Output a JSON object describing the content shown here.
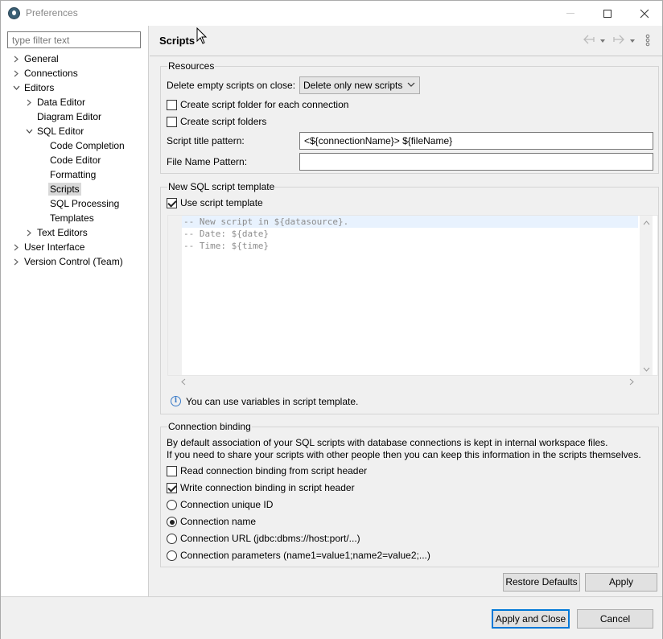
{
  "window": {
    "title": "Preferences",
    "controls": {
      "minimize": "minimize",
      "maximize": "maximize",
      "close": "close"
    }
  },
  "sidebar": {
    "filter_placeholder": "type filter text",
    "items": [
      {
        "label": "General",
        "expanded": false,
        "selected": false
      },
      {
        "label": "Connections",
        "expanded": false,
        "selected": false
      },
      {
        "label": "Editors",
        "expanded": true,
        "selected": false
      },
      {
        "label": "Data Editor",
        "expanded": false,
        "selected": false
      },
      {
        "label": "Diagram Editor",
        "selected": false
      },
      {
        "label": "SQL Editor",
        "expanded": true,
        "selected": false
      },
      {
        "label": "Code Completion",
        "selected": false
      },
      {
        "label": "Code Editor",
        "selected": false
      },
      {
        "label": "Formatting",
        "selected": false
      },
      {
        "label": "Scripts",
        "selected": true
      },
      {
        "label": "SQL Processing",
        "selected": false
      },
      {
        "label": "Templates",
        "selected": false
      },
      {
        "label": "Text Editors",
        "expanded": false,
        "selected": false
      },
      {
        "label": "User Interface",
        "expanded": false,
        "selected": false
      },
      {
        "label": "Version Control (Team)",
        "expanded": false,
        "selected": false
      }
    ]
  },
  "main": {
    "title": "Scripts",
    "resources": {
      "title": "Resources",
      "delete_empty_label": "Delete empty scripts on close:",
      "delete_empty_value": "Delete only new scripts",
      "create_folder_each_label": "Create script folder for each connection",
      "create_folder_each_checked": false,
      "create_folders_label": "Create script folders",
      "create_folders_checked": false,
      "title_pattern_label": "Script title pattern:",
      "title_pattern_value": "<${connectionName}> ${fileName}",
      "file_name_pattern_label": "File Name Pattern:",
      "file_name_pattern_value": ""
    },
    "template": {
      "title": "New SQL script template",
      "use_template_label": "Use script template",
      "use_template_checked": true,
      "lines": [
        "-- New script in ${datasource}.",
        "-- Date: ${date}",
        "-- Time: ${time}"
      ],
      "info": "You can use variables in script template."
    },
    "binding": {
      "title": "Connection binding",
      "desc1": "By default association of your SQL scripts with database connections is kept in internal workspace files.",
      "desc2": "If you need to share your scripts with other people then you can keep this information in the scripts themselves.",
      "read_header_label": "Read connection binding from script header",
      "read_header_checked": false,
      "write_header_label": "Write connection binding in script header",
      "write_header_checked": true,
      "options": [
        {
          "label": "Connection unique ID",
          "checked": false
        },
        {
          "label": "Connection name",
          "checked": true
        },
        {
          "label": "Connection URL (jdbc:dbms://host:port/...)",
          "checked": false
        },
        {
          "label": "Connection parameters (name1=value1;name2=value2;...)",
          "checked": false
        }
      ]
    },
    "buttons": {
      "restore_defaults": "Restore Defaults",
      "apply": "Apply"
    }
  },
  "footer": {
    "apply_and_close": "Apply and Close",
    "cancel": "Cancel"
  },
  "colors": {
    "accent": "#0078d7",
    "selection": "#d9d9d9",
    "current_line": "#e8f2fe"
  }
}
